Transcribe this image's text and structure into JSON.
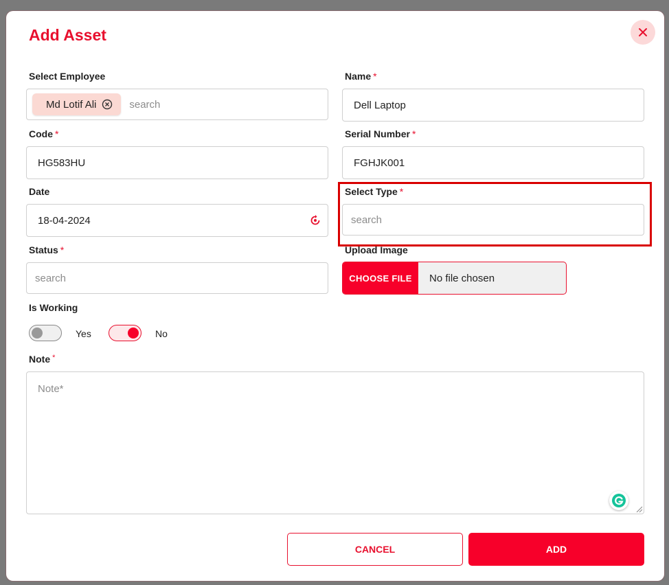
{
  "title": "Add Asset",
  "fields": {
    "employee": {
      "label": "Select Employee",
      "chip": "Md Lotif Ali",
      "placeholder": "search"
    },
    "name": {
      "label": "Name",
      "required": "*",
      "value": "Dell Laptop"
    },
    "code": {
      "label": "Code",
      "required": "*",
      "value": "HG583HU"
    },
    "serial": {
      "label": "Serial Number",
      "required": "*",
      "value": "FGHJK001"
    },
    "date": {
      "label": "Date",
      "value": "18-04-2024"
    },
    "type": {
      "label": "Select Type",
      "required": "*",
      "placeholder": "search"
    },
    "status": {
      "label": "Status",
      "required": "*",
      "placeholder": "search"
    },
    "upload": {
      "label": "Upload Image",
      "button": "CHOOSE FILE",
      "status": "No file chosen"
    },
    "working": {
      "label": "Is Working",
      "yes": "Yes",
      "no": "No",
      "yes_on": false,
      "no_on": true
    },
    "note": {
      "label": "Note",
      "required": "*",
      "placeholder": "Note*"
    }
  },
  "buttons": {
    "cancel": "CANCEL",
    "add": "ADD"
  },
  "colors": {
    "accent": "#f7002a",
    "highlight": "#d90000"
  }
}
